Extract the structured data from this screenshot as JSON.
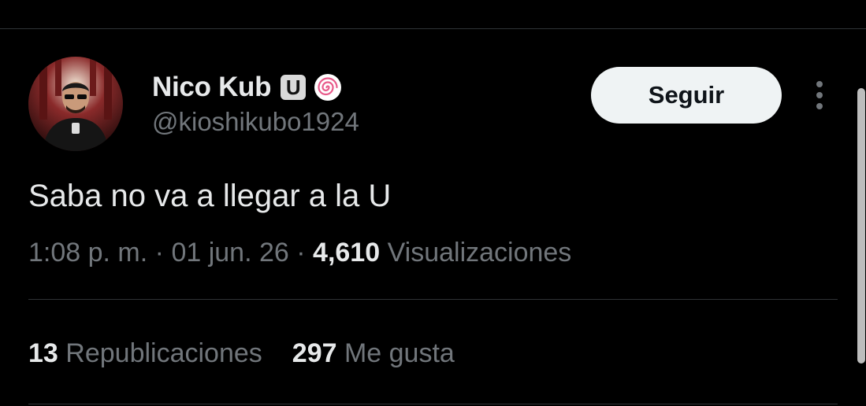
{
  "author": {
    "display_name": "Nico Kub",
    "badge_letter": "U",
    "handle": "@kioshikubo1924"
  },
  "actions": {
    "follow_label": "Seguir",
    "more_icon": "more-vertical-icon"
  },
  "tweet": {
    "text": "Saba no va a llegar a la U",
    "time": "1:08 p. m.",
    "separator": "·",
    "date": "01 jun. 26",
    "views_count": "4,610",
    "views_label": "Visualizaciones"
  },
  "stats": {
    "reposts_count": "13",
    "reposts_label": "Republicaciones",
    "likes_count": "297",
    "likes_label": "Me gusta"
  },
  "colors": {
    "background": "#000000",
    "primary_text": "#e7e9ea",
    "secondary_text": "#71767b",
    "divider": "#2f3336",
    "follow_button_bg": "#eff3f4",
    "badge_swirl": "#e85a8a"
  }
}
